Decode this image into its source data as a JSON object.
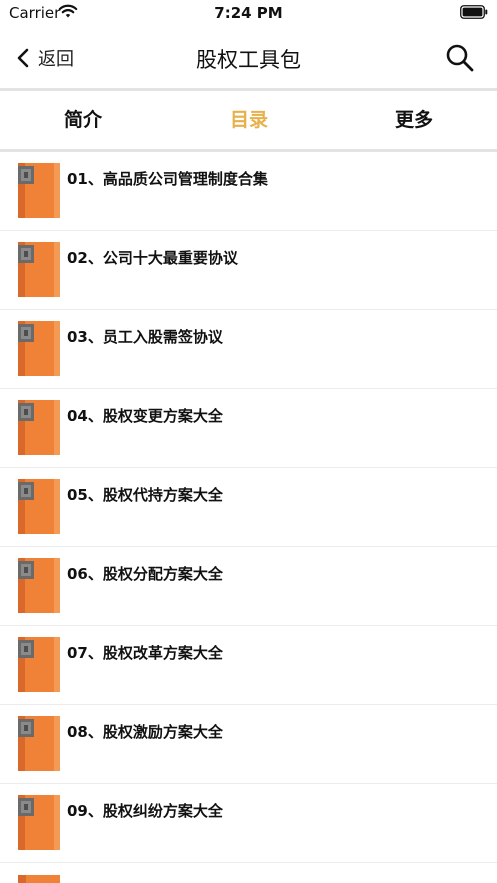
{
  "status_bar": {
    "carrier": "Carrier",
    "time": "7:24 PM"
  },
  "nav": {
    "back_label": "返回",
    "title": "股权工具包"
  },
  "tabs": [
    {
      "label": "简介"
    },
    {
      "label": "目录"
    },
    {
      "label": "更多"
    }
  ],
  "active_tab": "目录",
  "list": {
    "items": [
      {
        "title": "01、高品质公司管理制度合集"
      },
      {
        "title": "02、公司十大最重要协议"
      },
      {
        "title": "03、员工入股需签协议"
      },
      {
        "title": "04、股权变更方案大全"
      },
      {
        "title": "05、股权代持方案大全"
      },
      {
        "title": "06、股权分配方案大全"
      },
      {
        "title": "07、股权改革方案大全"
      },
      {
        "title": "08、股权激励方案大全"
      },
      {
        "title": "09、股权纠纷方案大全"
      }
    ]
  },
  "colors": {
    "accent": "#e8b04a",
    "book_orange": "#ef8236",
    "divider": "#e3e3e3"
  },
  "icons": {
    "back": "chevron-left-icon",
    "search": "search-icon",
    "book": "book-icon",
    "wifi": "wifi-icon",
    "battery": "battery-icon"
  }
}
